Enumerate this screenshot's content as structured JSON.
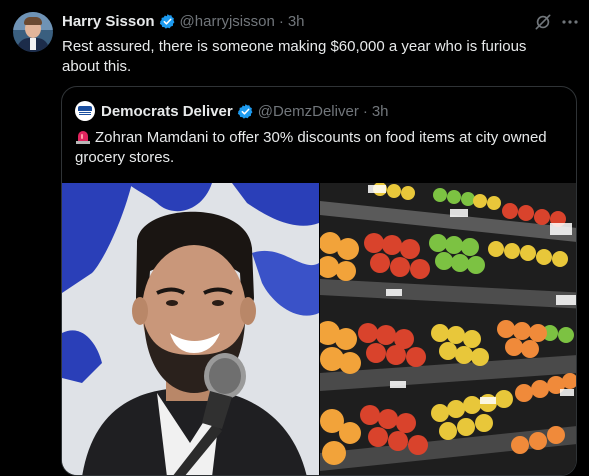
{
  "author": {
    "name": "Harry Sisson",
    "handle": "@harryjsisson",
    "time": "3h"
  },
  "tweet": {
    "text": "Rest assured, there is someone making $60,000 a year who is furious about this."
  },
  "quoted": {
    "name": "Democrats Deliver",
    "handle": "@DemzDeliver",
    "time": "3h",
    "text": "Zohran Mamdani to offer 30% discounts on food items at city owned grocery stores."
  },
  "colors": {
    "background": "#000000",
    "text": "#e7e9ea",
    "muted": "#71767b",
    "verified": "#1d9bf0",
    "border": "#2f3336"
  },
  "icons": {
    "verified": "verified-badge-icon",
    "grok": "grok-icon",
    "more": "more-icon",
    "siren": "police-light-emoji"
  }
}
